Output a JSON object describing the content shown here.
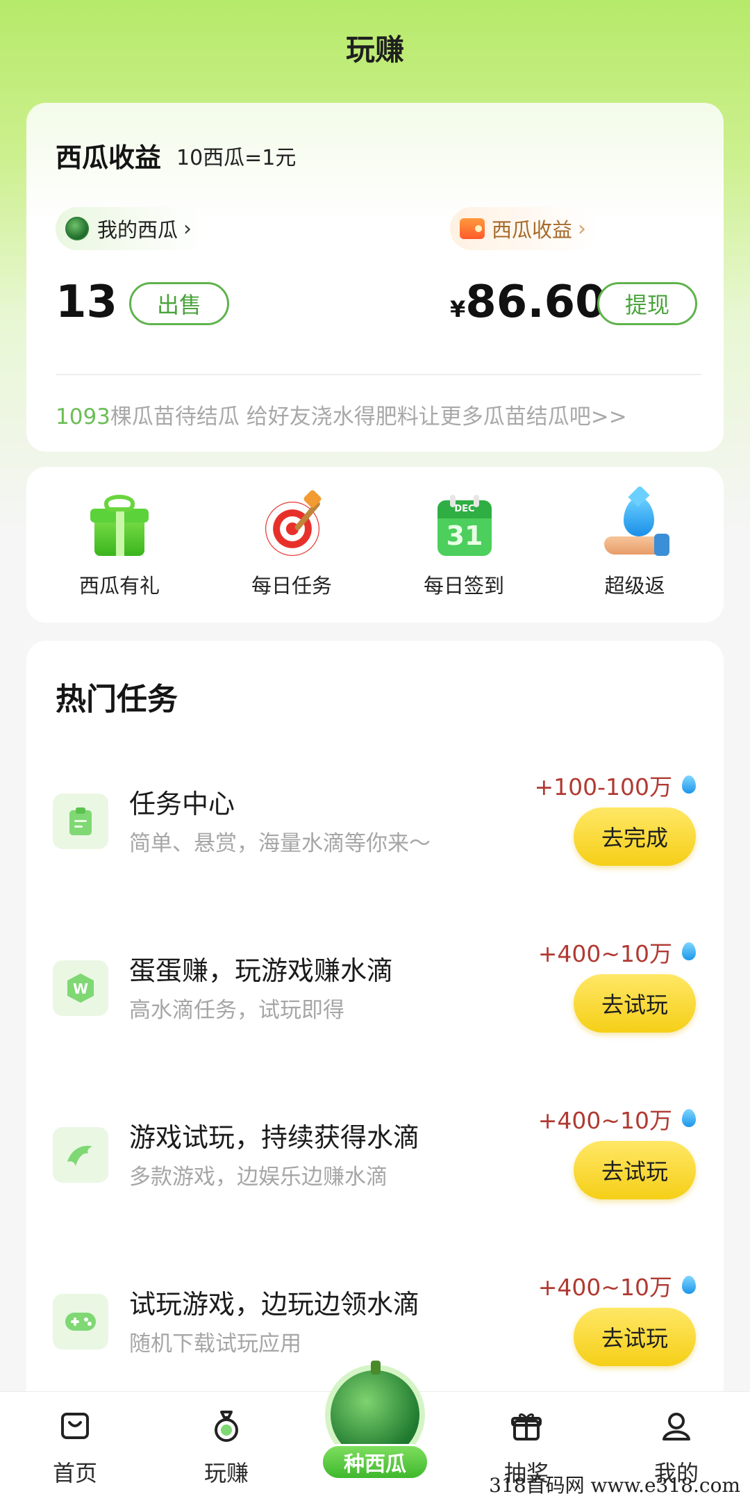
{
  "header": {
    "title": "玩赚"
  },
  "earnings": {
    "title": "西瓜收益",
    "rate": "10西瓜=1元",
    "my_melon_label": "我的西瓜",
    "melon_income_label": "西瓜收益",
    "melon_count": "13",
    "sell_label": "出售",
    "currency": "¥",
    "amount": "86.60",
    "withdraw_label": "提现",
    "tip_count": "1093",
    "tip_text": "棵瓜苗待结瓜 给好友浇水得肥料让更多瓜苗结瓜吧>>"
  },
  "quick": [
    {
      "label": "西瓜有礼",
      "icon": "gift-icon"
    },
    {
      "label": "每日任务",
      "icon": "target-icon"
    },
    {
      "label": "每日签到",
      "icon": "calendar-icon",
      "cal_month": "DEC",
      "cal_day": "31"
    },
    {
      "label": "超级返",
      "icon": "water-drop-hand-icon"
    }
  ],
  "hot": {
    "title": "热门任务",
    "tasks": [
      {
        "name": "任务中心",
        "desc": "简单、悬赏，海量水滴等你来～",
        "reward": "+100-100万",
        "button": "去完成",
        "icon": "clipboard-icon"
      },
      {
        "name": "蛋蛋赚，玩游戏赚水滴",
        "desc": "高水滴任务，试玩即得",
        "reward": "+400~10万",
        "button": "去试玩",
        "icon": "w-logo-icon"
      },
      {
        "name": "游戏试玩，持续获得水滴",
        "desc": "多款游戏，边娱乐边赚水滴",
        "reward": "+400~10万",
        "button": "去试玩",
        "icon": "dolphin-icon"
      },
      {
        "name": "试玩游戏，边玩边领水滴",
        "desc": "随机下载试玩应用",
        "reward": "+400~10万",
        "button": "去试玩",
        "icon": "gamepad-icon"
      }
    ]
  },
  "tabbar": {
    "home": "首页",
    "play_earn": "玩赚",
    "plant": "种西瓜",
    "lottery": "抽奖",
    "mine": "我的"
  },
  "watermark": "318首码网  www.e318.com",
  "colors": {
    "accent_green": "#5fb34c",
    "reward_red": "#b03a32",
    "button_yellow": "#f5cf17"
  }
}
